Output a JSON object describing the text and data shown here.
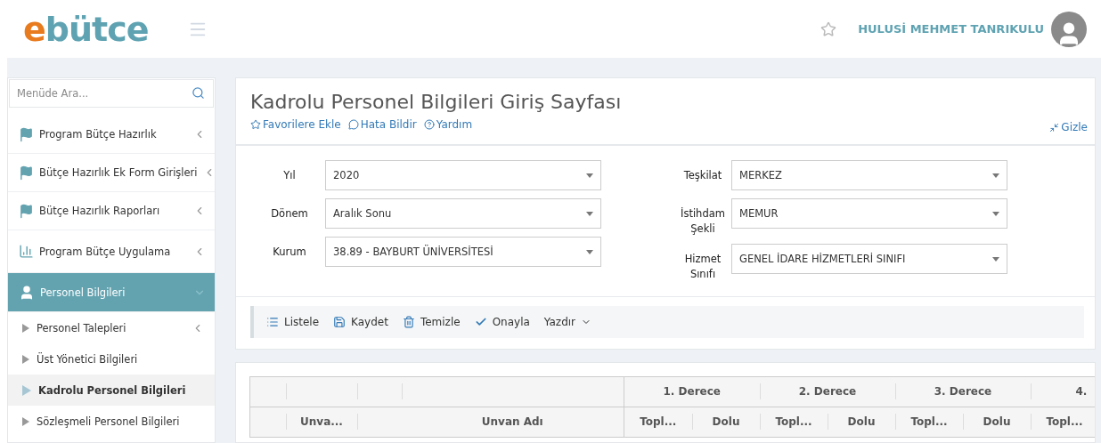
{
  "header": {
    "logo_accent": "e",
    "logo_rest": "bütce",
    "user_name": "HULUSİ MEHMET TANRIKULU"
  },
  "sidebar": {
    "search": {
      "placeholder": "Menüde Ara..."
    },
    "items": [
      {
        "label": "Program Bütçe Hazırlık",
        "kind": "flag",
        "selected": false,
        "expanded": false
      },
      {
        "label": "Bütçe Hazırlık Ek Form Girişleri",
        "kind": "flag",
        "selected": false,
        "expanded": false
      },
      {
        "label": "Bütçe Hazırlık Raporları",
        "kind": "flag",
        "selected": false,
        "expanded": false
      },
      {
        "label": "Program Bütçe Uygulama",
        "kind": "chart",
        "selected": false,
        "expanded": false
      },
      {
        "label": "Personel Bilgileri",
        "kind": "user",
        "selected": true,
        "expanded": true,
        "children": [
          {
            "label": "Personel Talepleri",
            "selected": false,
            "has_children": true
          },
          {
            "label": "Üst Yönetici Bilgileri",
            "selected": false,
            "has_children": false
          },
          {
            "label": "Kadrolu Personel Bilgileri",
            "selected": true,
            "has_children": false
          },
          {
            "label": "Sözleşmeli Personel Bilgileri",
            "selected": false,
            "has_children": false
          }
        ]
      }
    ]
  },
  "page": {
    "title": "Kadrolu Personel Bilgileri Giriş Sayfası",
    "links": [
      {
        "label": "Favorilere Ekle",
        "kind": "star"
      },
      {
        "label": "Hata Bildir",
        "kind": "comment"
      },
      {
        "label": "Yardım",
        "kind": "help"
      }
    ],
    "hide_link": "Gizle"
  },
  "form": {
    "left": [
      {
        "label": "Yıl",
        "value": "2020"
      },
      {
        "label": "Dönem",
        "value": "Aralık Sonu"
      },
      {
        "label": "Kurum",
        "value": "38.89 - BAYBURT ÜNİVERSİTESİ"
      }
    ],
    "right": [
      {
        "label": "Teşkilat",
        "value": "MERKEZ"
      },
      {
        "label": "İstihdam Şekli",
        "value": "MEMUR"
      },
      {
        "label": "Hizmet Sınıfı",
        "value": "GENEL İDARE HİZMETLERİ SINIFI"
      }
    ]
  },
  "toolbar": [
    {
      "label": "Listele",
      "kind": "list"
    },
    {
      "label": "Kaydet",
      "kind": "save"
    },
    {
      "label": "Temizle",
      "kind": "trash"
    },
    {
      "label": "Onayla",
      "kind": "check"
    },
    {
      "label": "Yazdır",
      "kind": "dropdown"
    }
  ],
  "table": {
    "group_headers": [
      "1. Derece",
      "2. Derece",
      "3. Derece",
      "4."
    ],
    "columns": [
      "Unva...",
      "Unvan Adı",
      "Topl...",
      "Dolu",
      "Topl...",
      "Dolu",
      "Topl...",
      "Dolu",
      "Topl..."
    ]
  }
}
